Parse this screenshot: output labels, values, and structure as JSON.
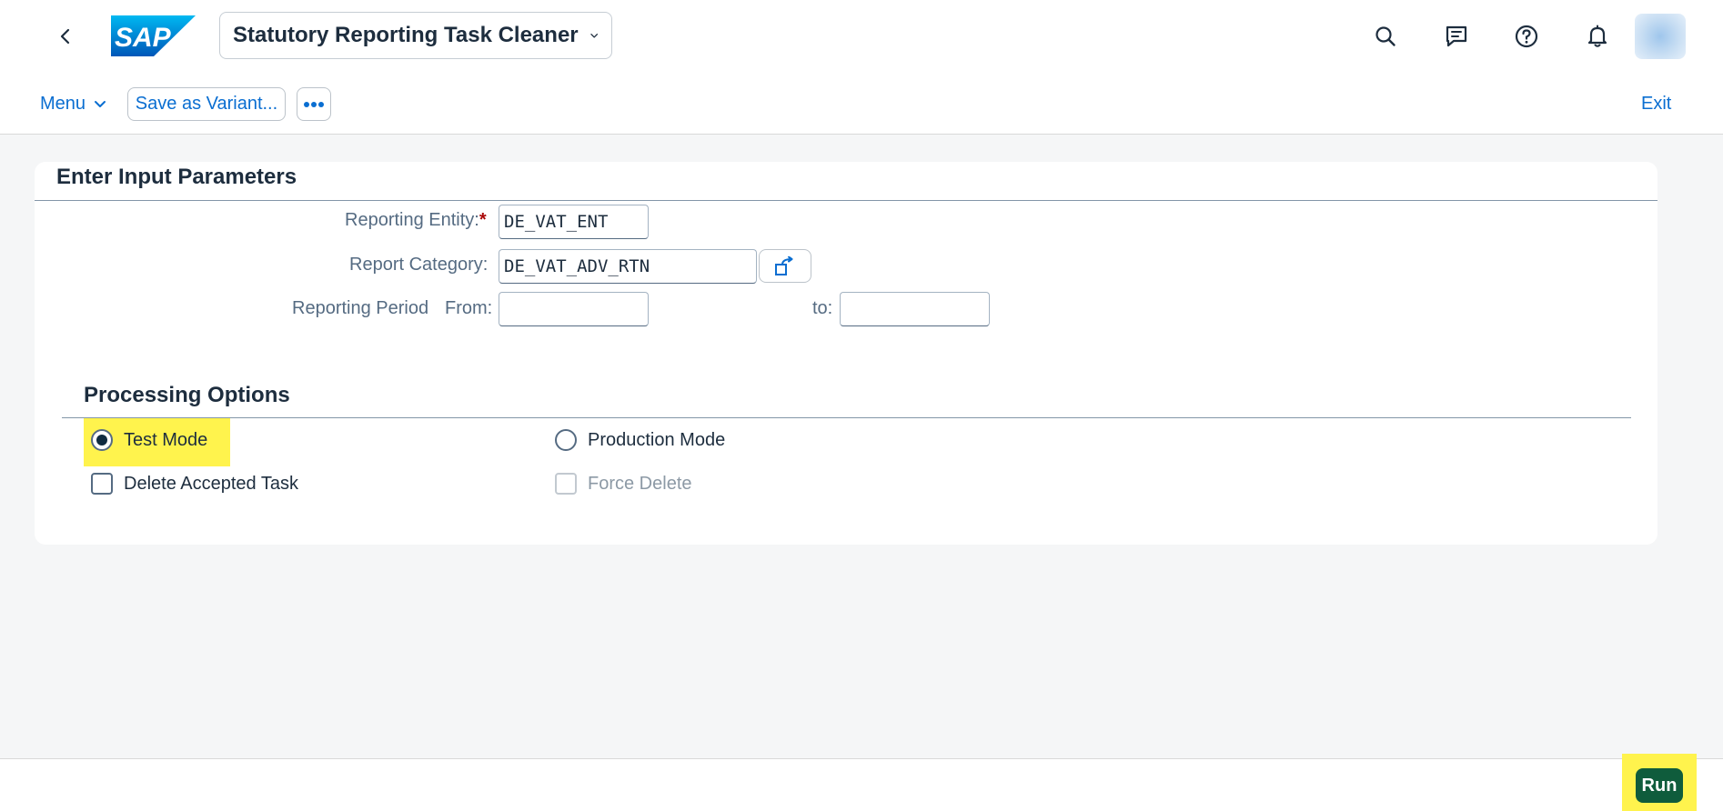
{
  "shell": {
    "logo_text": "SAP",
    "app_title": "Statutory Reporting Task Cleaner",
    "icons": [
      "back-icon",
      "search-icon",
      "feedback-icon",
      "help-icon",
      "notification-bell-icon",
      "user-avatar"
    ]
  },
  "toolbar": {
    "menu_label": "Menu",
    "save_variant_label": "Save as Variant...",
    "more_label": "•••",
    "exit_label": "Exit"
  },
  "input_section": {
    "title": "Enter Input Parameters",
    "reporting_entity_label": "Reporting Entity:",
    "required_marker": "*",
    "reporting_entity_value": "DE_VAT_ENT",
    "report_category_label": "Report Category:",
    "report_category_value": "DE_VAT_ADV_RTN",
    "reporting_period_label": "Reporting Period",
    "from_label": "From:",
    "from_value": "",
    "to_label": "to:",
    "to_value": ""
  },
  "processing_section": {
    "title": "Processing Options",
    "test_mode_label": "Test Mode",
    "test_mode_selected": true,
    "production_mode_label": "Production Mode",
    "production_mode_selected": false,
    "delete_accepted_label": "Delete Accepted Task",
    "delete_accepted_checked": false,
    "force_delete_label": "Force Delete",
    "force_delete_checked": false,
    "force_delete_enabled": false
  },
  "footer": {
    "run_label": "Run"
  },
  "colors": {
    "accent": "#0a6ed1",
    "highlight": "#fff34d",
    "run_button": "#0f5c3c",
    "background": "#f5f6f7",
    "required": "#aa0808"
  }
}
